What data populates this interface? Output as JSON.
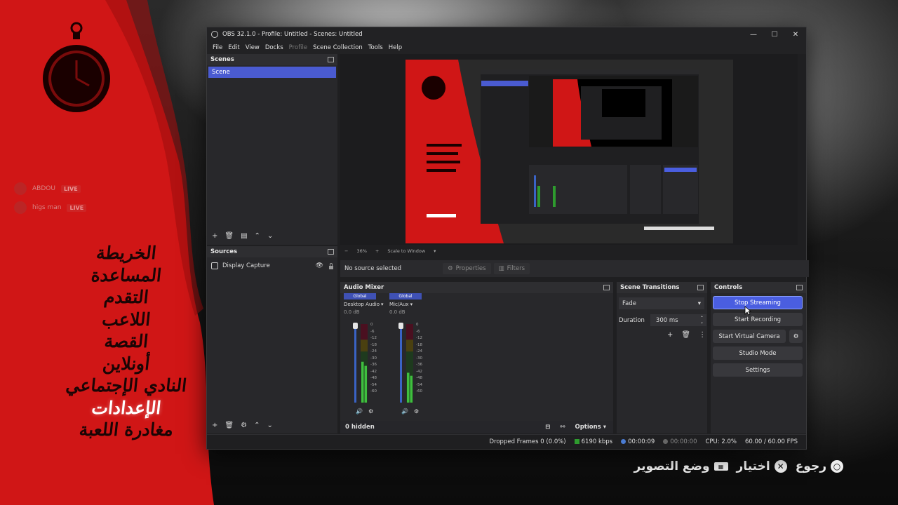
{
  "window": {
    "title": "OBS 32.1.0 - Profile: Untitled - Scenes: Untitled",
    "controls": [
      "—",
      "☐",
      "✕"
    ]
  },
  "menubar": [
    "File",
    "Edit",
    "View",
    "Docks",
    "Profile",
    "Scene Collection",
    "Tools",
    "Help"
  ],
  "scenes": {
    "header": "Scenes",
    "items": [
      "Scene"
    ]
  },
  "sources": {
    "header": "Sources",
    "items": [
      {
        "name": "Display Capture"
      }
    ]
  },
  "preview": {
    "zoom": "36%",
    "scale_mode": "Scale to Window"
  },
  "properties_bar": {
    "no_source": "No source selected",
    "properties_label": "Properties",
    "filters_label": "Filters"
  },
  "audio_mixer": {
    "header": "Audio Mixer",
    "channels": [
      {
        "badge": "Global",
        "name": "Desktop Audio",
        "db": "0.0 dB",
        "level": 0.52
      },
      {
        "badge": "Global",
        "name": "Mic/Aux",
        "db": "0.0 dB",
        "level": 0.38
      }
    ],
    "scale": [
      "0",
      "-6",
      "-12",
      "-18",
      "-24",
      "-30",
      "-36",
      "-42",
      "-48",
      "-54",
      "-60"
    ],
    "hidden_label": "0 hidden",
    "options_label": "Options"
  },
  "scene_transitions": {
    "header": "Scene Transitions",
    "transition": "Fade",
    "duration_label": "Duration",
    "duration_value": "300 ms"
  },
  "controls": {
    "header": "Controls",
    "stop_streaming": "Stop Streaming",
    "start_recording": "Start Recording",
    "start_virtual_camera": "Start Virtual Camera",
    "studio_mode": "Studio Mode",
    "settings": "Settings"
  },
  "statusbar": {
    "dropped_frames": "Dropped Frames 0 (0.0%)",
    "bitrate": "6190 kbps",
    "stream_time": "00:00:09",
    "record_time": "00:00:00",
    "cpu": "CPU: 2.0%",
    "fps": "60.00 / 60.00 FPS"
  },
  "game": {
    "feed": [
      {
        "name": "ABDOU",
        "live": "LIVE"
      },
      {
        "name": "higs man",
        "live": "LIVE"
      }
    ],
    "menu": [
      "الخريطة",
      "المساعدة",
      "التقدم",
      "اللاعب",
      "القصة",
      "أونلاين",
      "النادي الإجتماعي",
      "الإعدادات",
      "مغادرة اللعبة"
    ],
    "selected_index": 7,
    "hints": [
      {
        "label": "رجوع",
        "icon": "○"
      },
      {
        "label": "اختيار",
        "icon": "✕"
      },
      {
        "label": "وضع التصوير",
        "icon": "▦"
      }
    ]
  }
}
